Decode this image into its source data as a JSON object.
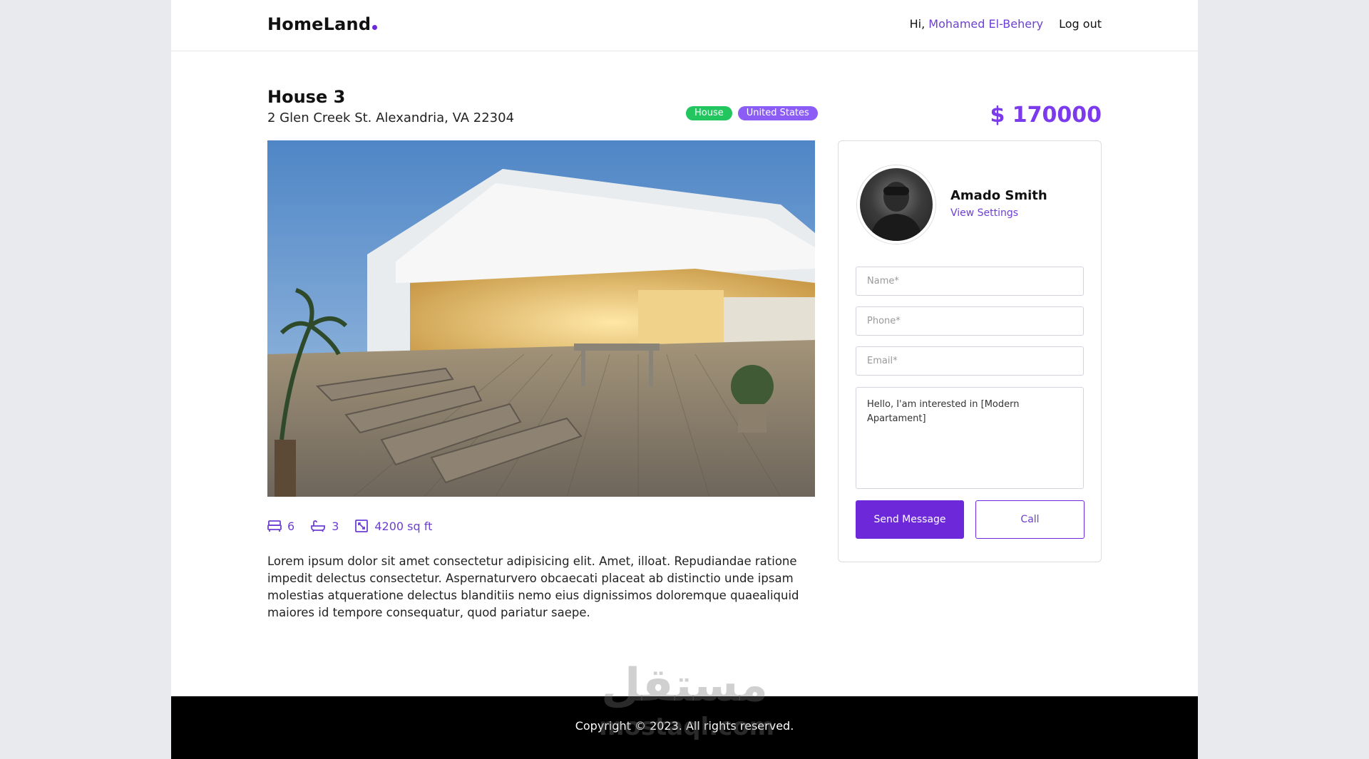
{
  "header": {
    "logo": "HomeLand",
    "greeting": "Hi,",
    "user_name": "Mohamed El-Behery",
    "logout": "Log out"
  },
  "listing": {
    "title": "House 3",
    "address": "2 Glen Creek St. Alexandria, VA 22304",
    "badges": [
      "House",
      "United States"
    ],
    "price": "$ 170000",
    "features": {
      "beds": "6",
      "baths": "3",
      "area": "4200 sq ft"
    },
    "description": "Lorem ipsum dolor sit amet consectetur adipisicing elit. Amet, illoat. Repudiandae ratione impedit delectus consectetur. Aspernaturvero obcaecati placeat ab distinctio unde ipsam molestias atqueratione delectus blanditiis nemo eius dignissimos doloremque quaealiquid maiores id tempore consequatur, quod pariatur saepe."
  },
  "agent": {
    "name": "Amado Smith",
    "link": "View Settings"
  },
  "form": {
    "name_placeholder": "Name*",
    "phone_placeholder": "Phone*",
    "email_placeholder": "Email*",
    "message_value": "Hello, I'am interested in [Modern Apartament]",
    "send_label": "Send Message",
    "call_label": "Call"
  },
  "footer": {
    "copyright": "Copyright © 2023. All rights reserved."
  },
  "watermark": {
    "arabic": "مستقل",
    "latin": "mostaql.com"
  },
  "colors": {
    "accent": "#6d28d9",
    "badge_house": "#22c55e",
    "badge_country": "#8b5cf6"
  },
  "icons": [
    "bed-icon",
    "bath-icon",
    "area-icon"
  ]
}
